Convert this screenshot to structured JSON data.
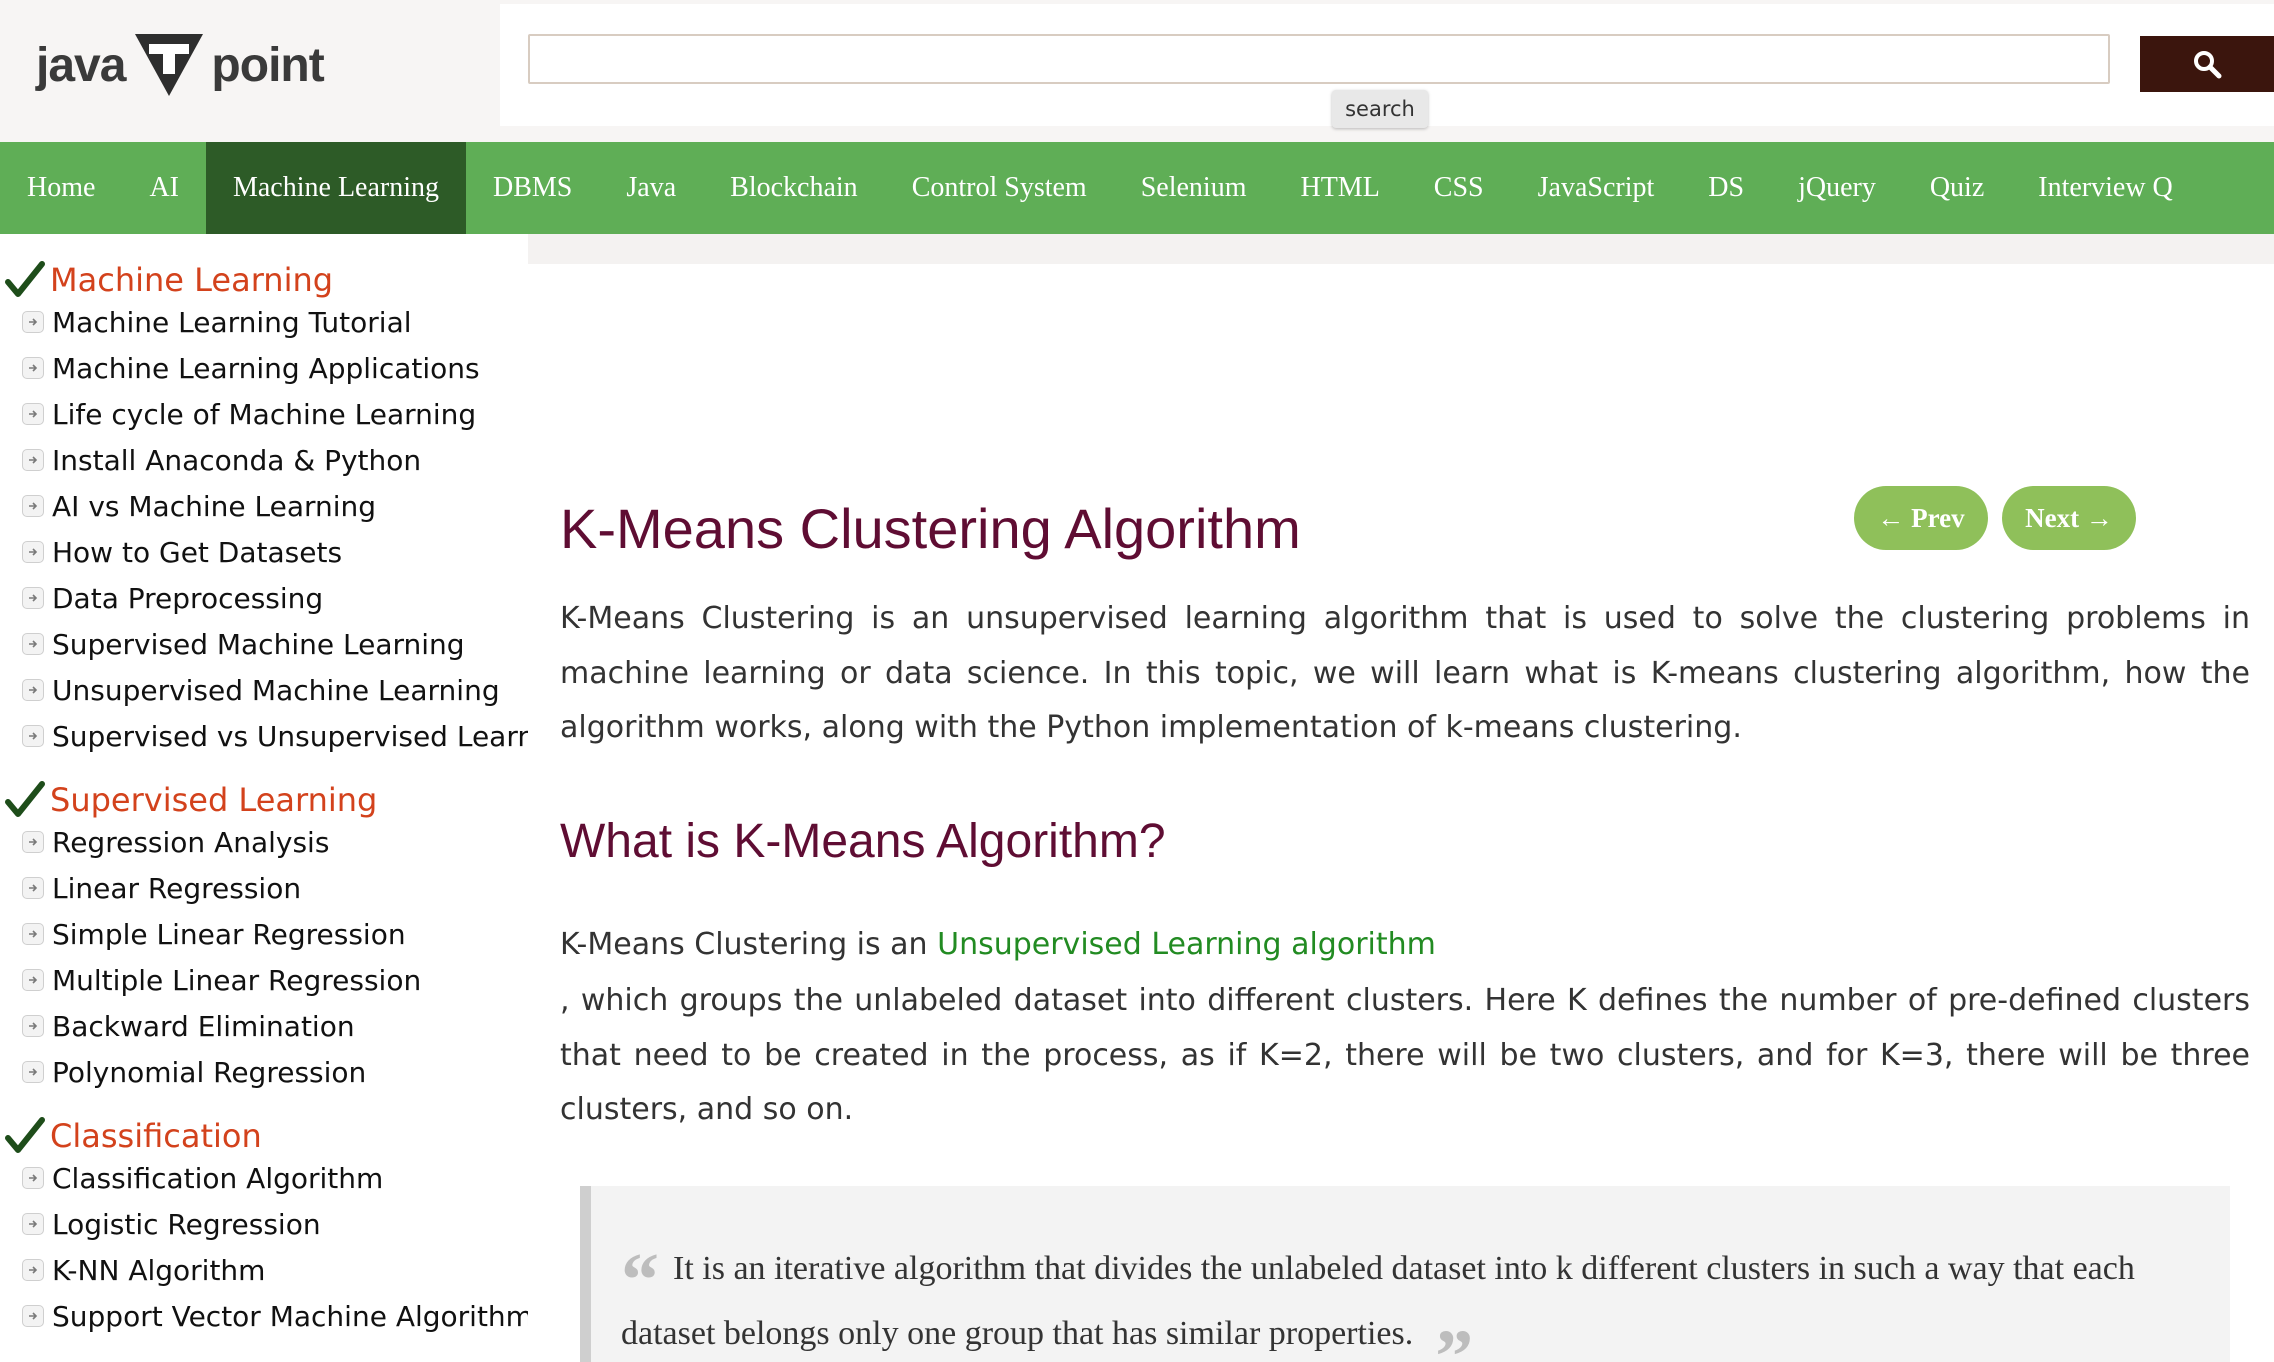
{
  "header": {
    "logo_text_left": "java",
    "logo_text_right": "point",
    "search_placeholder": "",
    "search_tooltip": "search",
    "search_icon": "magnifier-icon"
  },
  "nav": {
    "items": [
      "Home",
      "AI",
      "Machine Learning",
      "DBMS",
      "Java",
      "Blockchain",
      "Control System",
      "Selenium",
      "HTML",
      "CSS",
      "JavaScript",
      "DS",
      "jQuery",
      "Quiz",
      "Interview Q"
    ],
    "active": "Machine Learning"
  },
  "sidebar": {
    "sections": [
      {
        "title": "Machine Learning",
        "items": [
          "Machine Learning Tutorial",
          "Machine Learning Applications",
          "Life cycle of Machine Learning",
          "Install Anaconda & Python",
          "AI vs Machine Learning",
          "How to Get Datasets",
          "Data Preprocessing",
          "Supervised Machine Learning",
          "Unsupervised Machine Learning",
          "Supervised vs Unsupervised Learning"
        ]
      },
      {
        "title": "Supervised Learning",
        "items": [
          "Regression Analysis",
          "Linear Regression",
          "Simple Linear Regression",
          "Multiple Linear Regression",
          "Backward Elimination",
          "Polynomial Regression"
        ]
      },
      {
        "title": "Classification",
        "items": [
          "Classification Algorithm",
          "Logistic Regression",
          "K-NN Algorithm",
          "Support Vector Machine Algorithm"
        ]
      }
    ]
  },
  "main": {
    "title": "K-Means Clustering Algorithm",
    "prev_label": "← Prev",
    "next_label": "Next →",
    "intro": "K-Means Clustering is an unsupervised learning algorithm that is used to solve the clustering problems in machine learning or data science. In this topic, we will learn what is K-means clustering algorithm, how the algorithm works, along with the Python implementation of k-means clustering.",
    "h2": "What is K-Means Algorithm?",
    "p2_prefix": "K-Means Clustering is an ",
    "p2_link": "Unsupervised Learning algorithm",
    "p2_rest": ", which groups the unlabeled dataset into different clusters. Here K defines the number of pre-defined clusters that need to be created in the process, as if K=2, there will be two clusters, and for K=3, there will be three clusters, and so on.",
    "quote": "It is an iterative algorithm that divides the unlabeled dataset into k different clusters in such a way that each dataset belongs only one group that has similar properties.",
    "quote_open": "“",
    "quote_close": "”"
  },
  "colors": {
    "nav_bg": "#5fae56",
    "nav_active": "#2d5b27",
    "title": "#5f0d33",
    "sidebar_heading": "#d3421c",
    "link": "#228b22",
    "button": "#8fc05a",
    "search_button": "#3b150d"
  }
}
